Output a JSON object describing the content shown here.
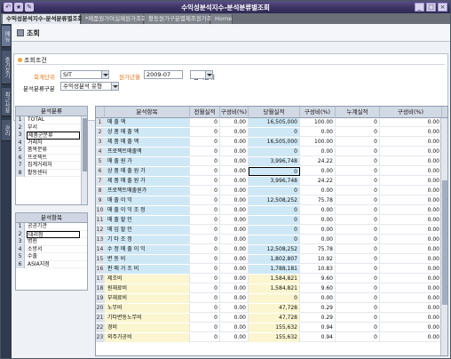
{
  "window": {
    "title": "수익성분석지수-분석분류별조회",
    "quick_icons": [
      "↶",
      "★",
      "✎"
    ],
    "controls": [
      "_",
      "□",
      "×"
    ]
  },
  "tabs": [
    {
      "label": "수익성분석지수-분석분류별조회",
      "active": true,
      "closable": true
    },
    {
      "label": "*제품원가여실제원가조회",
      "active": false
    },
    {
      "label": "활동원가구분별제조원가조회",
      "active": false
    },
    {
      "label": "Home",
      "active": false
    }
  ],
  "left_tabs": [
    "메뉴",
    "즐겨찾기",
    "최근사용",
    "관리"
  ],
  "header": {
    "title": "조회"
  },
  "conditions": {
    "section_title": "조회조건",
    "company_label": "회계단위",
    "company_value": "SIT",
    "period_label": "원가년월",
    "period_value": "2009-07",
    "unit_label": "금액단위",
    "unit_value": "",
    "class_label": "분석분류구분",
    "class_value": "수익성분석 유형"
  },
  "category_list": {
    "header": "분석분류",
    "items": [
      "TOTAL",
      "부서",
      "제품군분류",
      "거래처",
      "품목분류",
      "프로젝트",
      "집계거래처",
      "활동센터"
    ],
    "selected_index": 2
  },
  "item_list": {
    "header": "분석항목",
    "items": [
      "공공기관",
      "대리점",
      "병원",
      "소방서",
      "수출",
      "ASIA지점"
    ],
    "selected_index": 1
  },
  "grid": {
    "columns": [
      "분석항목",
      "전월실적",
      "구성비(%)",
      "당월실적",
      "구성비(%)",
      "누계실적",
      "구성비(%)"
    ],
    "rows": [
      {
        "no": "1",
        "name": "매   출   액",
        "c1": "0",
        "p1": "0.00",
        "c2": "16,505,000",
        "p2": "100.00",
        "c3": "0",
        "p3": "0.00",
        "style": "blue"
      },
      {
        "no": "2",
        "name": "  상 품 매 출 액",
        "c1": "0",
        "p1": "0.00",
        "c2": "0",
        "p2": "0.00",
        "c3": "0",
        "p3": "0.00",
        "style": "blue"
      },
      {
        "no": "3",
        "name": "  제 품 매 출 액",
        "c1": "0",
        "p1": "0.00",
        "c2": "16,505,000",
        "p2": "100.00",
        "c3": "0",
        "p3": "0.00",
        "style": "blue"
      },
      {
        "no": "4",
        "name": "  프로젝트매출액",
        "c1": "0",
        "p1": "0.00",
        "c2": "0",
        "p2": "0.00",
        "c3": "0",
        "p3": "0.00",
        "style": "blue"
      },
      {
        "no": "5",
        "name": "매 출 원 가",
        "c1": "0",
        "p1": "0.00",
        "c2": "3,996,748",
        "p2": "24.22",
        "c3": "0",
        "p3": "0.00",
        "style": "blue"
      },
      {
        "no": "6",
        "name": "  상 품 매 출 원 가",
        "c1": "0",
        "p1": "0.00",
        "c2": "0",
        "p2": "0.00",
        "c3": "0",
        "p3": "0.00",
        "style": "blue",
        "selected": true
      },
      {
        "no": "7",
        "name": "  제 품 매 출 원 가",
        "c1": "0",
        "p1": "0.00",
        "c2": "3,996,748",
        "p2": "24.22",
        "c3": "0",
        "p3": "0.00",
        "style": "blue"
      },
      {
        "no": "8",
        "name": "  프로젝트매출원가",
        "c1": "0",
        "p1": "0.00",
        "c2": "0",
        "p2": "0.00",
        "c3": "0",
        "p3": "0.00",
        "style": "blue"
      },
      {
        "no": "9",
        "name": "매 출 이 익",
        "c1": "0",
        "p1": "0.00",
        "c2": "12,508,252",
        "p2": "75.78",
        "c3": "0",
        "p3": "0.00",
        "style": "blue"
      },
      {
        "no": "10",
        "name": "매 출 이 익 조 정",
        "c1": "0",
        "p1": "0.00",
        "c2": "0",
        "p2": "0.00",
        "c3": "0",
        "p3": "0.00",
        "style": "blue"
      },
      {
        "no": "11",
        "name": "  매 출 할 인",
        "c1": "0",
        "p1": "0.00",
        "c2": "0",
        "p2": "0.00",
        "c3": "0",
        "p3": "0.00",
        "style": "blue"
      },
      {
        "no": "12",
        "name": "  매 입 할 인",
        "c1": "0",
        "p1": "0.00",
        "c2": "0",
        "p2": "0.00",
        "c3": "0",
        "p3": "0.00",
        "style": "blue"
      },
      {
        "no": "13",
        "name": "  기 타 조 정",
        "c1": "0",
        "p1": "0.00",
        "c2": "0",
        "p2": "0.00",
        "c3": "0",
        "p3": "0.00",
        "style": "blue"
      },
      {
        "no": "14",
        "name": "수 정 매 출 이 익",
        "c1": "0",
        "p1": "0.00",
        "c2": "12,508,252",
        "p2": "75.78",
        "c3": "0",
        "p3": "0.00",
        "style": "blue"
      },
      {
        "no": "15",
        "name": "변 동 비",
        "c1": "0",
        "p1": "0.00",
        "c2": "1,802,807",
        "p2": "10.92",
        "c3": "0",
        "p3": "0.00",
        "style": "blue"
      },
      {
        "no": "16",
        "name": "  판 매 거 조 비",
        "c1": "0",
        "p1": "0.00",
        "c2": "1,788,181",
        "p2": "10.83",
        "c3": "0",
        "p3": "0.00",
        "style": "blue"
      },
      {
        "no": "17",
        "name": "    제조비",
        "c1": "0",
        "p1": "0.00",
        "c2": "1,584,821",
        "p2": "9.60",
        "c3": "0",
        "p3": "0.00",
        "style": "yellow"
      },
      {
        "no": "18",
        "name": "      원재료비",
        "c1": "0",
        "p1": "0.00",
        "c2": "1,584,821",
        "p2": "9.60",
        "c3": "0",
        "p3": "0.00",
        "style": "yellow"
      },
      {
        "no": "19",
        "name": "      부재료비",
        "c1": "0",
        "p1": "0.00",
        "c2": "0",
        "p2": "0.00",
        "c3": "0",
        "p3": "0.00",
        "style": "yellow"
      },
      {
        "no": "20",
        "name": "    노무비",
        "c1": "0",
        "p1": "0.00",
        "c2": "47,728",
        "p2": "0.29",
        "c3": "0",
        "p3": "0.00",
        "style": "yellow"
      },
      {
        "no": "21",
        "name": "      기타변동노무비",
        "c1": "0",
        "p1": "0.00",
        "c2": "47,728",
        "p2": "0.29",
        "c3": "0",
        "p3": "0.00",
        "style": "yellow"
      },
      {
        "no": "22",
        "name": "    경비",
        "c1": "0",
        "p1": "0.00",
        "c2": "155,632",
        "p2": "0.94",
        "c3": "0",
        "p3": "0.00",
        "style": "yellow"
      },
      {
        "no": "23",
        "name": "      외주가공비",
        "c1": "0",
        "p1": "0.00",
        "c2": "155,632",
        "p2": "0.94",
        "c3": "0",
        "p3": "0.00",
        "style": "yellow"
      }
    ]
  }
}
